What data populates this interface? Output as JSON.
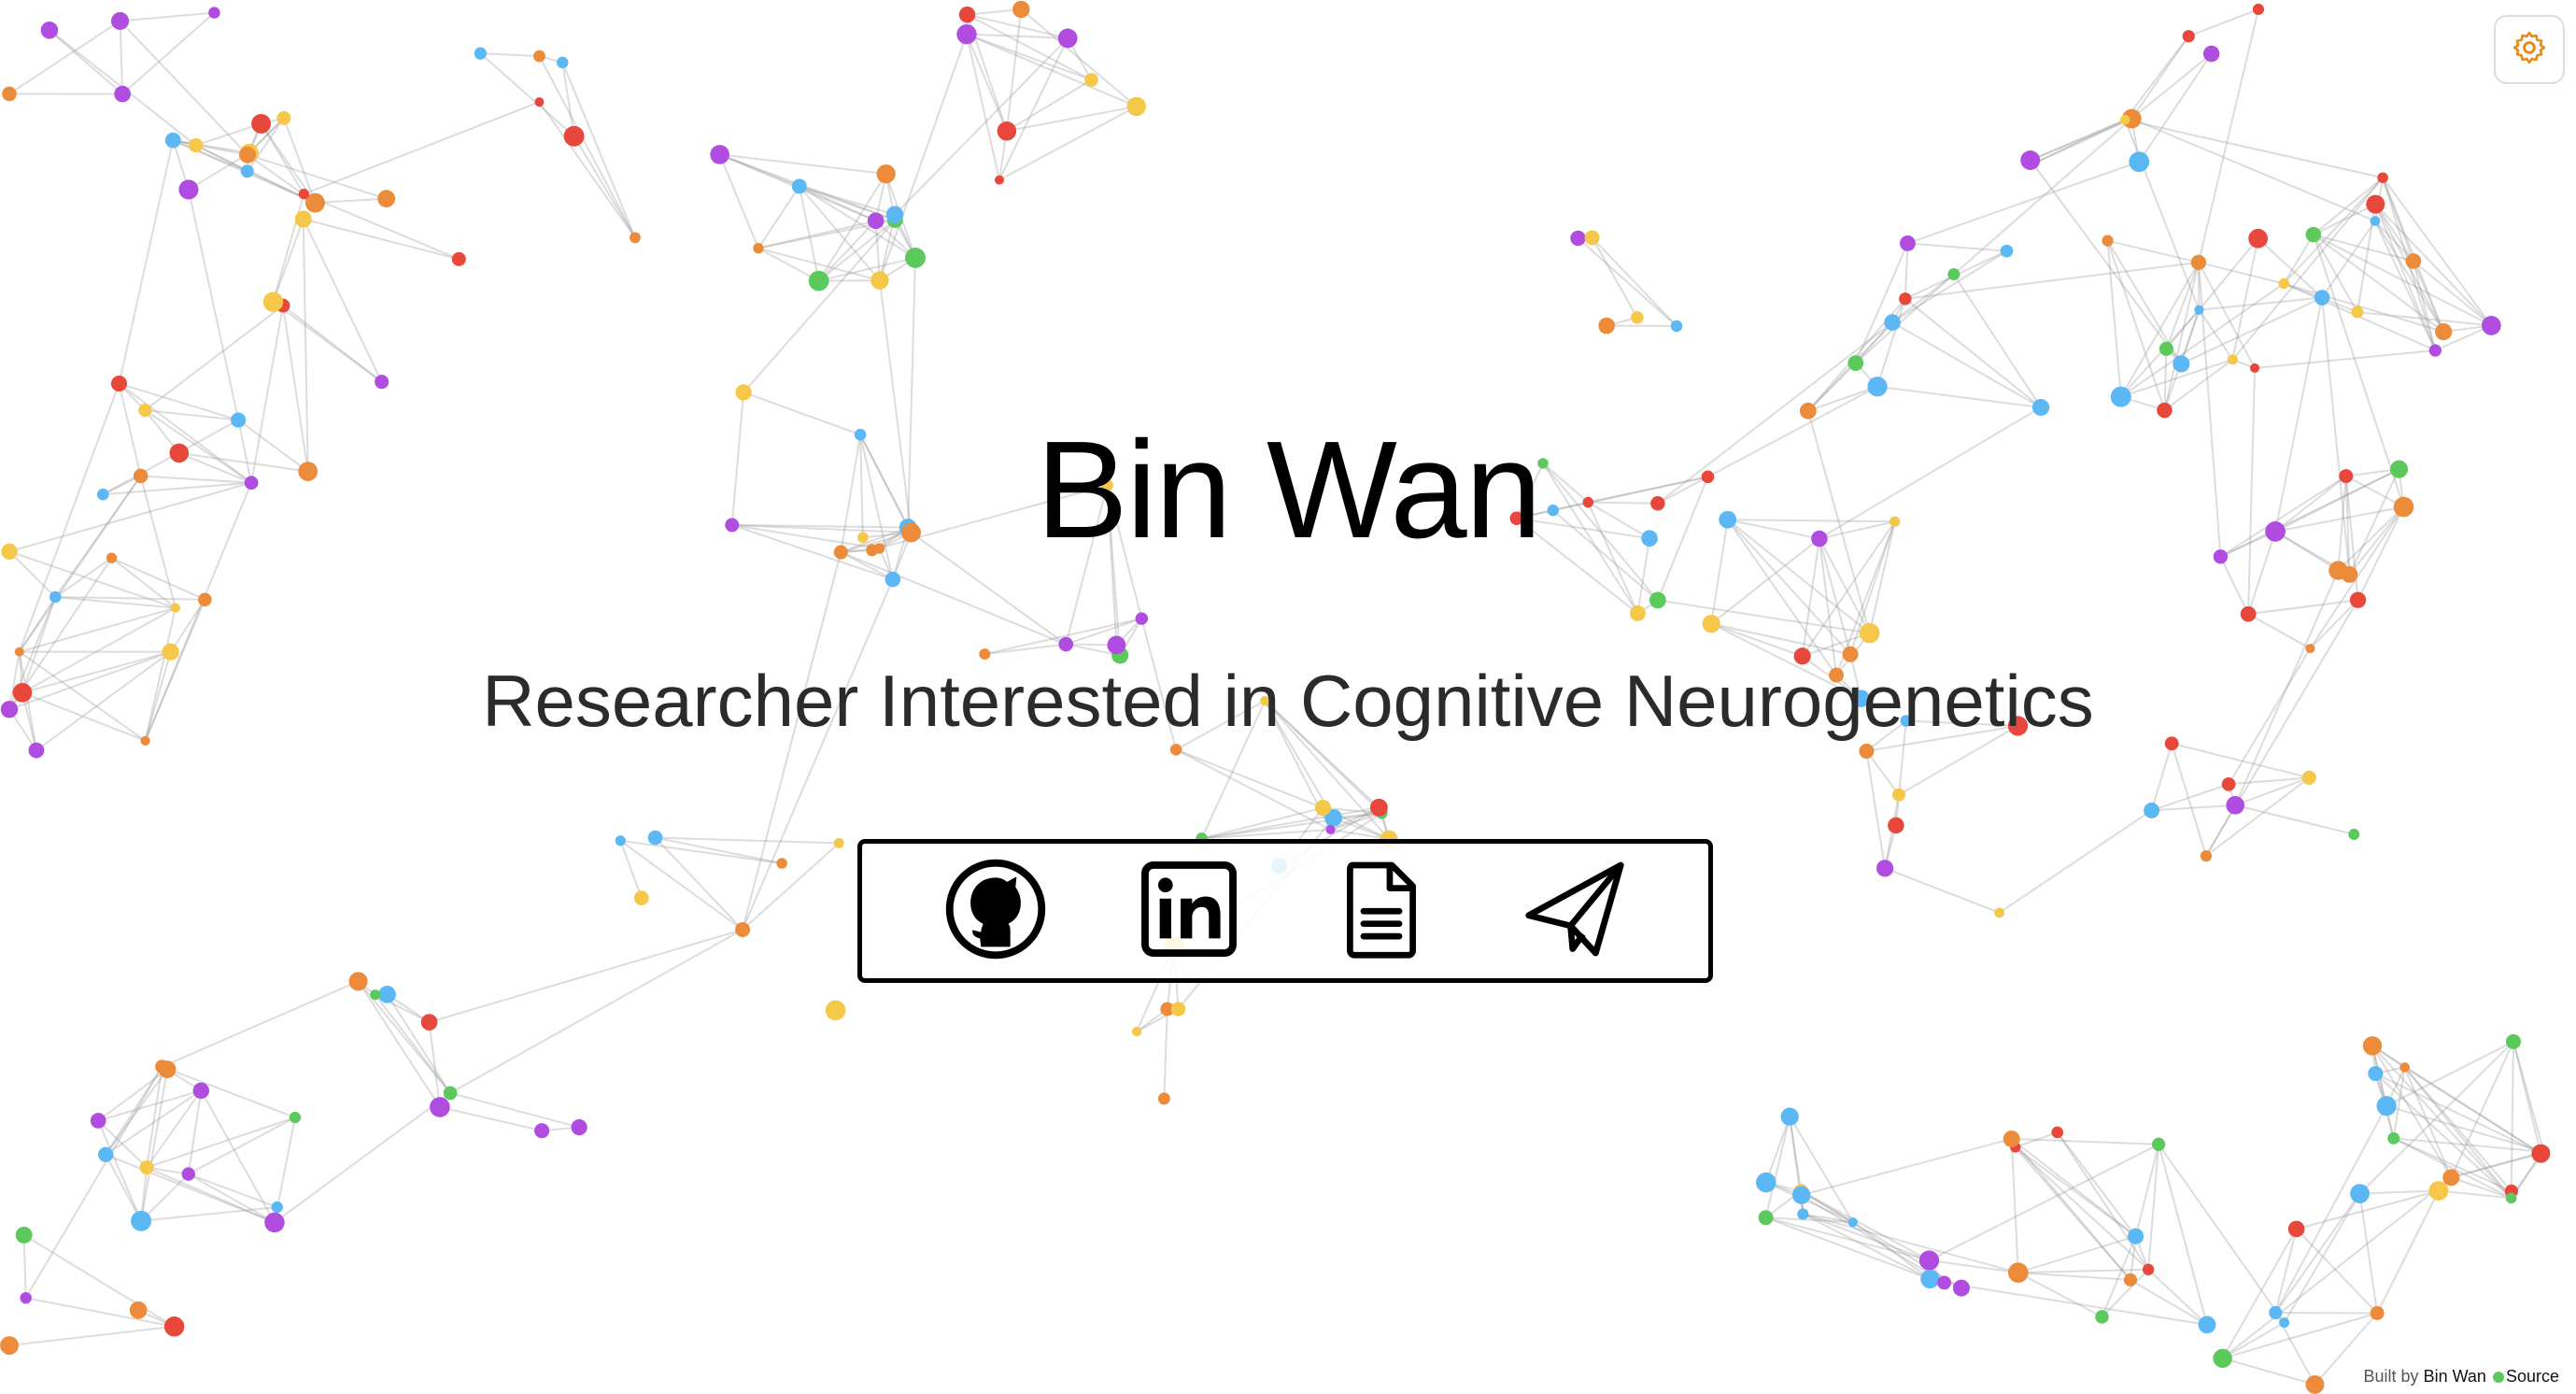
{
  "page": {
    "name": "Bin Wan",
    "tagline": "Researcher Interested in Cognitive Neurogenetics"
  },
  "links": [
    {
      "id": "github",
      "icon": "github-icon",
      "label": "GitHub"
    },
    {
      "id": "linkedin",
      "icon": "linkedin-icon",
      "label": "LinkedIn"
    },
    {
      "id": "cv",
      "icon": "document-icon",
      "label": "CV"
    },
    {
      "id": "contact",
      "icon": "paper-plane-icon",
      "label": "Contact"
    }
  ],
  "settings": {
    "icon": "gear-icon",
    "color": "#e88a1a"
  },
  "footer": {
    "prefix": "Built by",
    "author": "Bin Wan",
    "source_label": "Source"
  },
  "palette": [
    "#e8473b",
    "#f5c84a",
    "#5cc95c",
    "#5bb8f5",
    "#b04ce0",
    "#ec8b3a"
  ]
}
